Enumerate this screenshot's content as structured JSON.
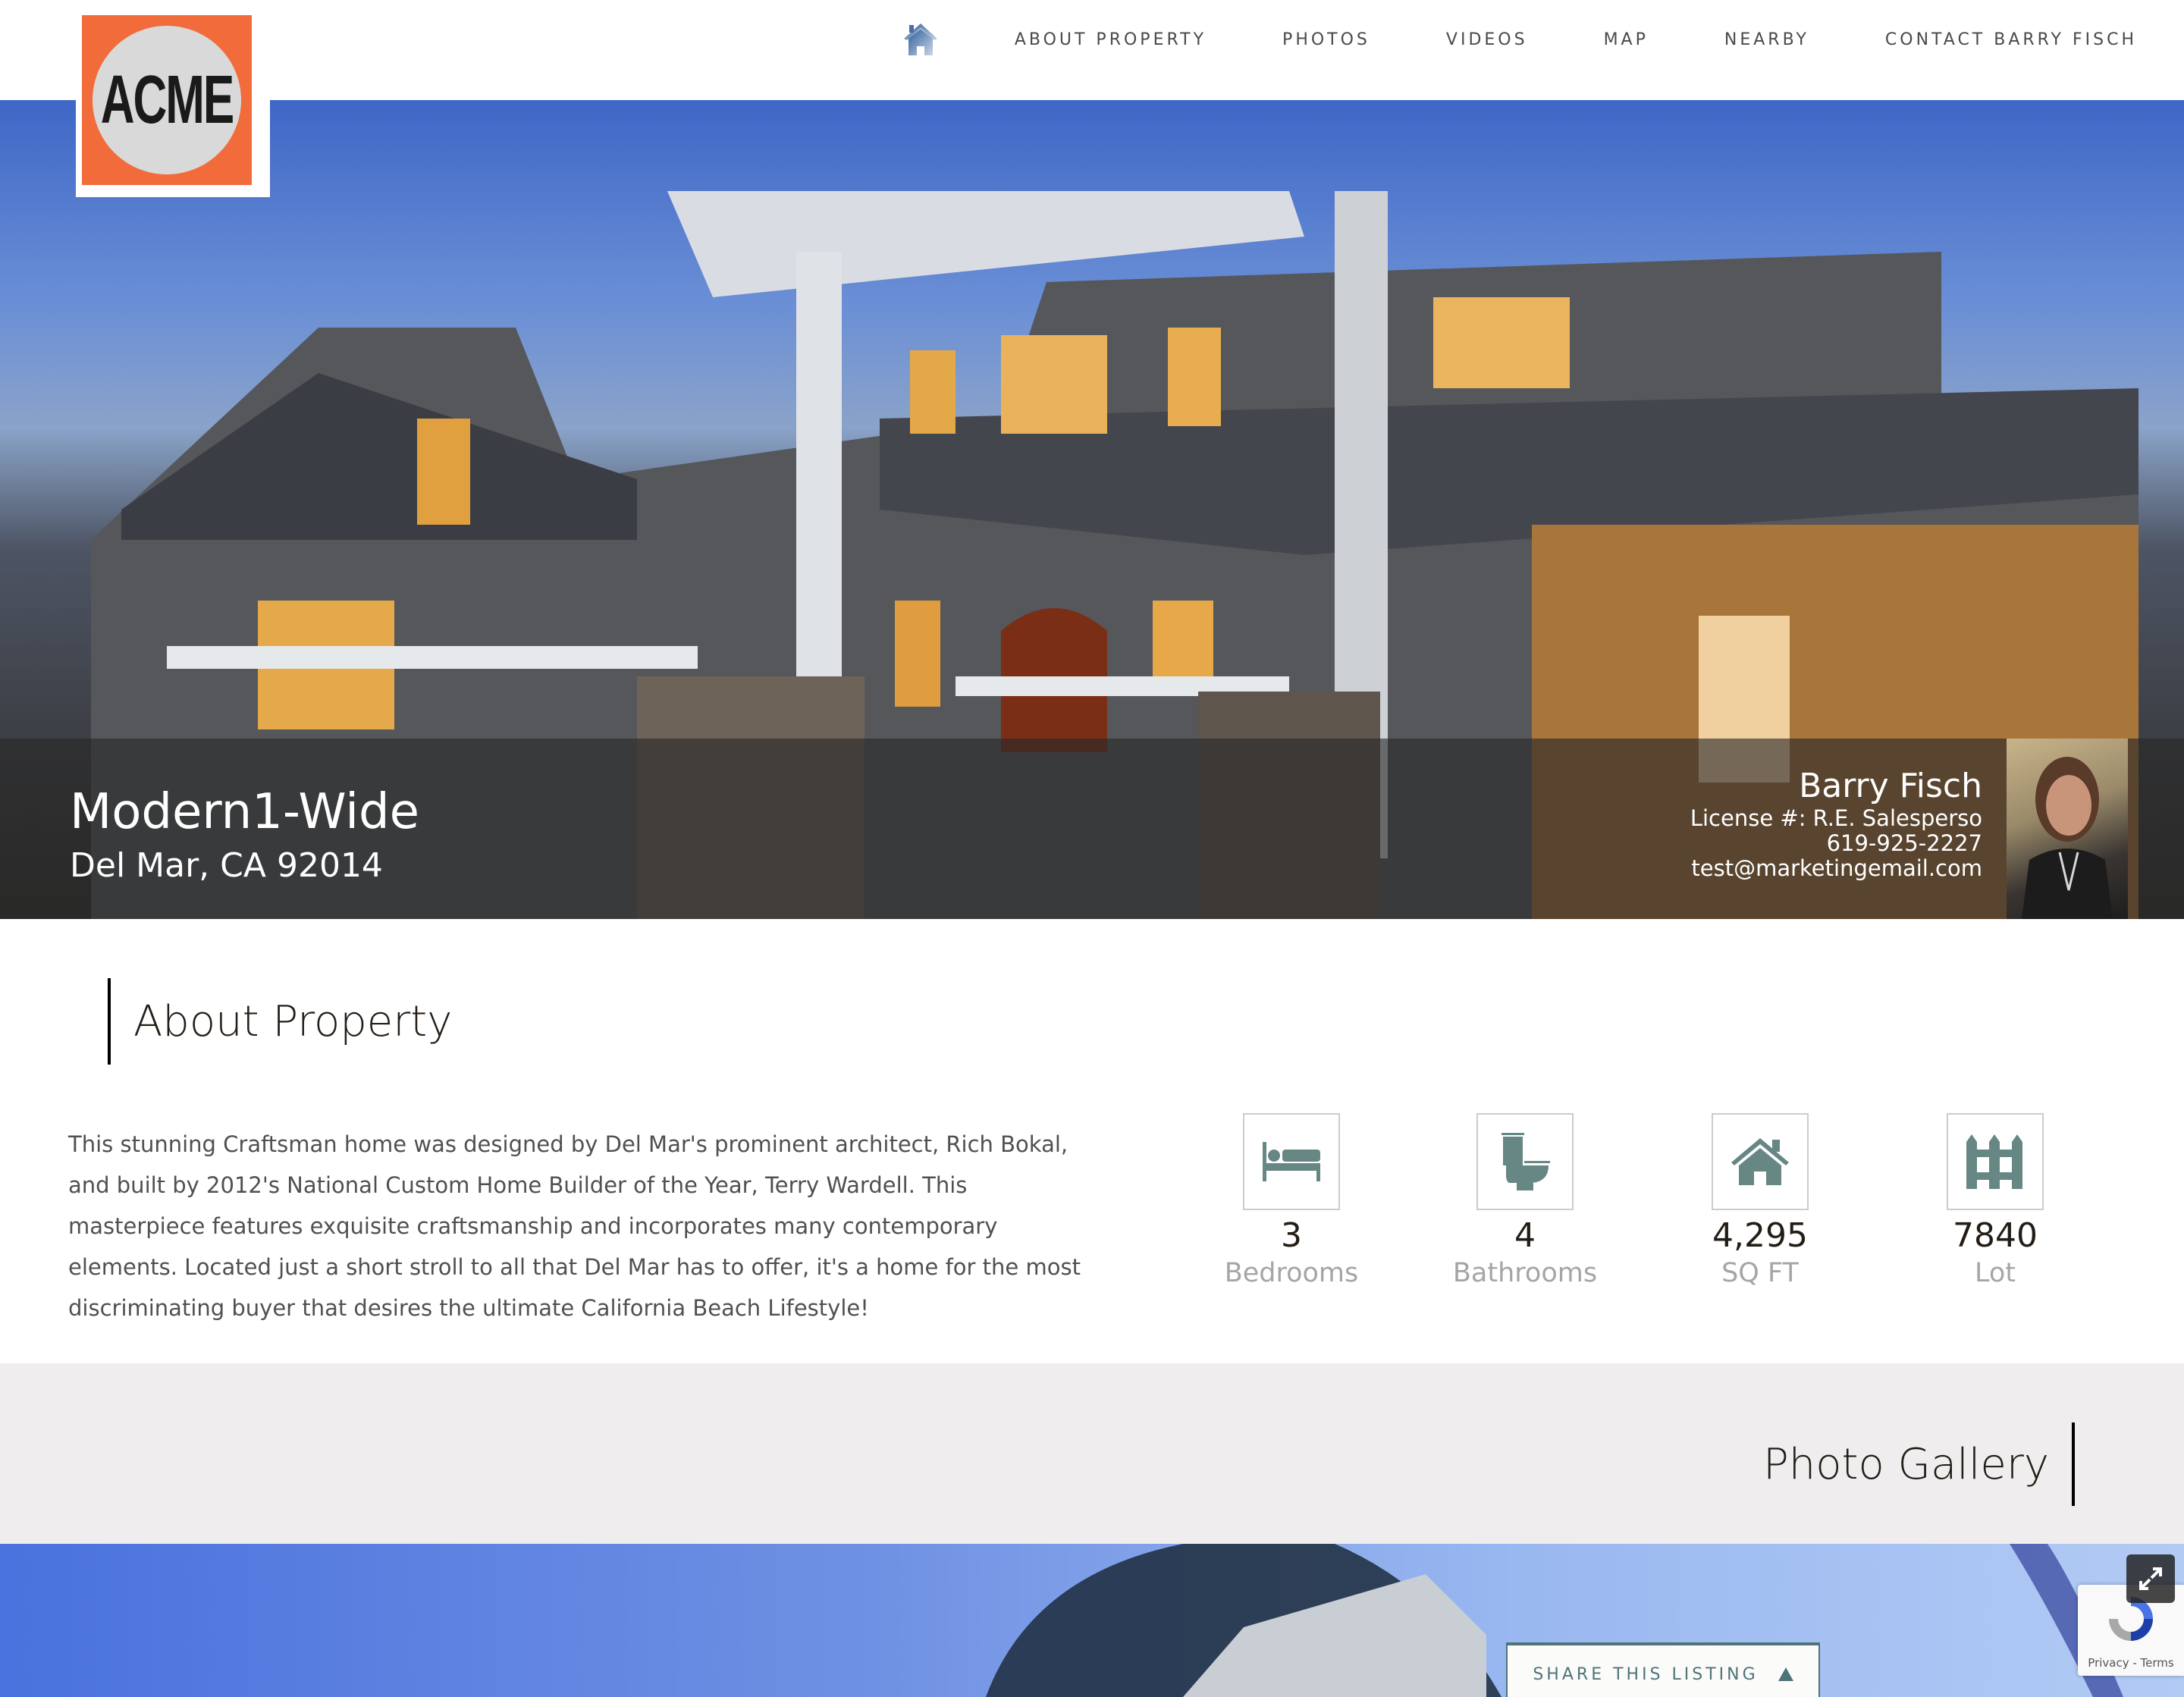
{
  "brand": {
    "logo_text": "ACME",
    "logo_color": "#f26b3a"
  },
  "nav": {
    "home_icon": "home-icon",
    "items": [
      {
        "label": "ABOUT PROPERTY"
      },
      {
        "label": "PHOTOS"
      },
      {
        "label": "VIDEOS"
      },
      {
        "label": "MAP"
      },
      {
        "label": "NEARBY"
      },
      {
        "label": "CONTACT BARRY FISCH"
      }
    ]
  },
  "hero": {
    "title": "Modern1-Wide",
    "address": "Del Mar, CA 92014",
    "agent": {
      "name": "Barry Fisch",
      "license": "License #: R.E. Salesperso",
      "phone": "619-925-2227",
      "email": "test@marketingemail.com"
    }
  },
  "about": {
    "heading": "About Property",
    "description": "This stunning Craftsman home was designed by Del Mar's prominent architect, Rich Bokal, and built by 2012's National Custom Home Builder of the Year, Terry Wardell. This masterpiece features exquisite craftsmanship and incorporates many contemporary elements. Located just a short stroll to all that Del Mar has to offer, it's a home for the most discriminating buyer that desires the ultimate California Beach Lifestyle!",
    "stats": [
      {
        "icon": "bed-icon",
        "value": "3",
        "label": "Bedrooms"
      },
      {
        "icon": "toilet-icon",
        "value": "4",
        "label": "Bathrooms"
      },
      {
        "icon": "house-icon",
        "value": "4,295",
        "label": "SQ FT"
      },
      {
        "icon": "fence-icon",
        "value": "7840",
        "label": "Lot"
      }
    ],
    "icon_color": "#668784"
  },
  "gallery": {
    "heading": "Photo Gallery",
    "share_label": "SHARE THIS LISTING",
    "accent_color": "#4f7478"
  },
  "recaptcha": {
    "footer": "Privacy - Terms"
  }
}
